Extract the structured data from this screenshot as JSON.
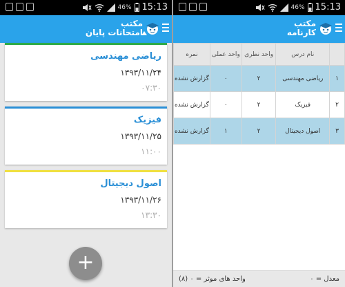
{
  "left": {
    "status": {
      "time": "15:13",
      "battery": "46%"
    },
    "title_line1": "مکتب",
    "title_line2": "امتحانات پایان",
    "exams": [
      {
        "name": "ریاضی مهندسی",
        "date": "۱۳۹۳/۱۱/۲۴",
        "time": "۰۷:۳۰",
        "color": "#2eaa4a"
      },
      {
        "name": "فیزیک",
        "date": "۱۳۹۳/۱۱/۲۵",
        "time": "۱۱:۰۰",
        "color": "#2a8fd6"
      },
      {
        "name": "اصول دیجیتال",
        "date": "۱۳۹۳/۱۱/۲۶",
        "time": "۱۳:۳۰",
        "color": "#f0e040"
      }
    ],
    "fab_symbol": "+"
  },
  "right": {
    "status": {
      "time": "15:13",
      "battery": "46%"
    },
    "title_line1": "مکتب",
    "title_line2": "کارنامه",
    "table": {
      "headers": [
        "",
        "نام درس",
        "واحد نظری",
        "واحد عملی",
        "نمره"
      ],
      "rows": [
        {
          "index": "۱",
          "course": "ریاضی مهندسی",
          "theory": "۲",
          "practical": "۰",
          "grade": "گزارش نشده",
          "highlight": true
        },
        {
          "index": "۲",
          "course": "فیزیک",
          "theory": "۲",
          "practical": "۰",
          "grade": "گزارش نشده",
          "highlight": false
        },
        {
          "index": "۳",
          "course": "اصول دیجیتال",
          "theory": "۲",
          "practical": "۱",
          "grade": "گزارش نشده",
          "highlight": true
        }
      ]
    },
    "footer": {
      "average": "معدل = ۰",
      "units": "واحد های موثر = ۰ (۸)"
    }
  },
  "colors": {
    "appbar": "#2aa3ea",
    "highlight_row": "#aed6e8",
    "fab": "#8d8d8d"
  },
  "icons": {
    "menu": "hamburger-icon",
    "logo": "graduation-cap-icon",
    "add": "plus-icon"
  }
}
